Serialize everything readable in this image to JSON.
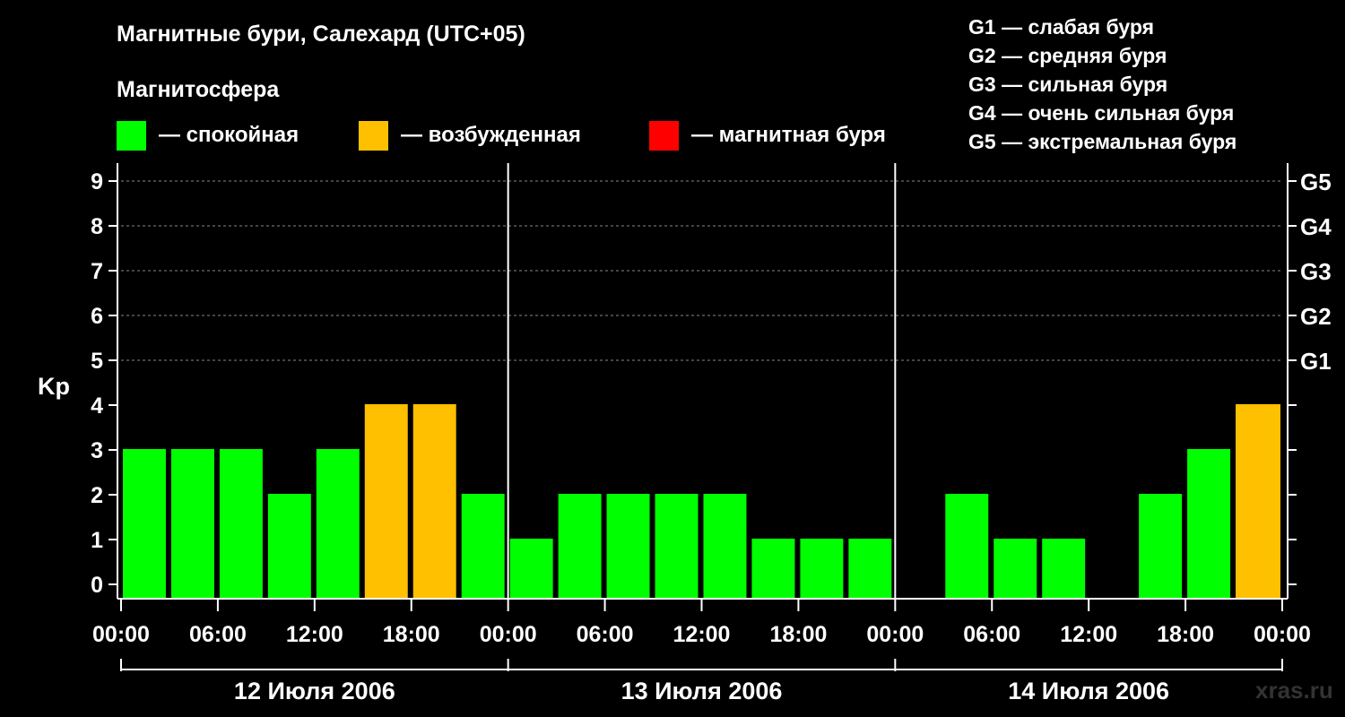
{
  "title": "Магнитные бури, Салехард (UTC+05)",
  "subtitle": "Магнитосфера",
  "legend": [
    {
      "label": "— спокойная",
      "color": "#00ff00"
    },
    {
      "label": "— возбужденная",
      "color": "#ffc000"
    },
    {
      "label": "— магнитная буря",
      "color": "#ff0000"
    }
  ],
  "g_legend": [
    "G1 — слабая буря",
    "G2 — средняя буря",
    "G3 — сильная буря",
    "G4 — очень сильная буря",
    "G5 — экстремальная буря"
  ],
  "watermark": "xras.ru",
  "chart_data": {
    "type": "bar",
    "ylabel": "Kp",
    "ylim": [
      0,
      9
    ],
    "y_ticks": [
      "0",
      "1",
      "2",
      "3",
      "4",
      "5",
      "6",
      "7",
      "8",
      "9"
    ],
    "g_ticks": [
      {
        "kp": 5,
        "label": "G1"
      },
      {
        "kp": 6,
        "label": "G2"
      },
      {
        "kp": 7,
        "label": "G3"
      },
      {
        "kp": 8,
        "label": "G4"
      },
      {
        "kp": 9,
        "label": "G5"
      }
    ],
    "x_tick_labels": [
      "00:00",
      "06:00",
      "12:00",
      "18:00",
      "00:00",
      "06:00",
      "12:00",
      "18:00",
      "00:00",
      "06:00",
      "12:00",
      "18:00",
      "00:00"
    ],
    "days": [
      "12 Июля 2006",
      "13 Июля 2006",
      "14 Июля 2006"
    ],
    "bar_interval_hours": 3,
    "values": [
      3,
      3,
      3,
      2,
      3,
      4,
      4,
      2,
      1,
      2,
      2,
      2,
      2,
      1,
      1,
      1,
      0,
      2,
      1,
      1,
      0,
      2,
      3,
      4
    ],
    "status": [
      "quiet",
      "quiet",
      "quiet",
      "quiet",
      "quiet",
      "excited",
      "excited",
      "quiet",
      "quiet",
      "quiet",
      "quiet",
      "quiet",
      "quiet",
      "quiet",
      "quiet",
      "quiet",
      "none",
      "quiet",
      "quiet",
      "quiet",
      "none",
      "quiet",
      "quiet",
      "excited"
    ],
    "partial_bar": {
      "kp": 4,
      "status": "excited"
    },
    "colors": {
      "quiet": "#00ff00",
      "excited": "#ffc000",
      "storm": "#ff0000"
    },
    "grid": "dashed horizontal at each Kp level"
  }
}
